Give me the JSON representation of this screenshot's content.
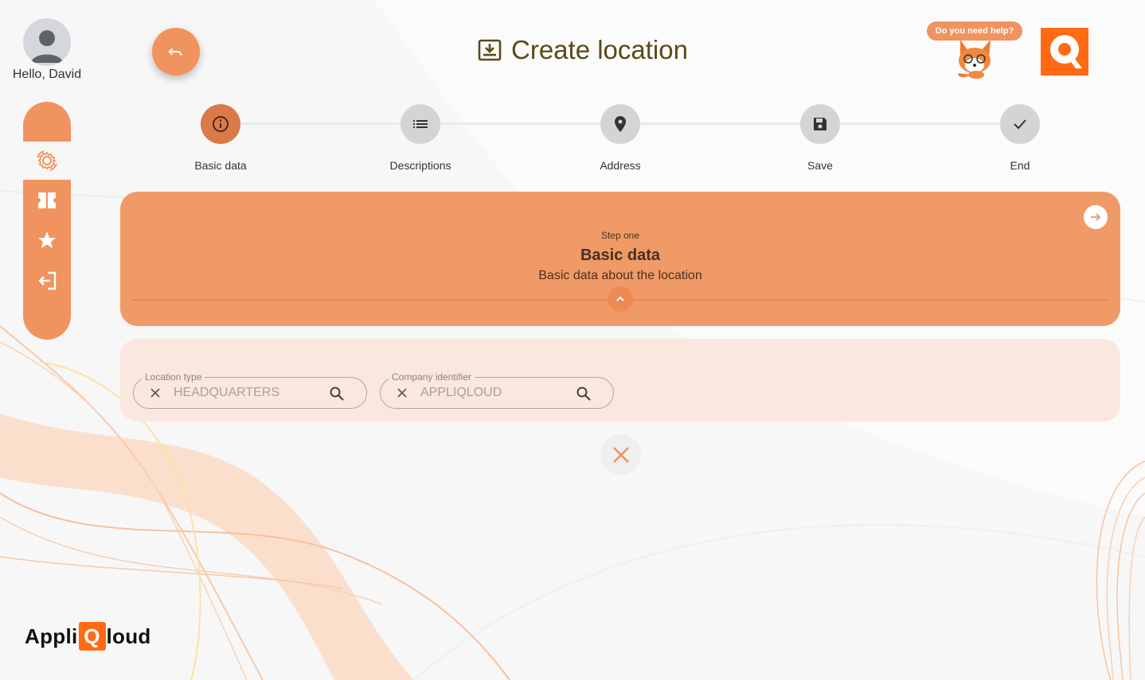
{
  "user": {
    "greeting": "Hello, David"
  },
  "header": {
    "title": "Create location"
  },
  "help": {
    "label": "Do you need help?"
  },
  "logo": {
    "letter": "Q"
  },
  "sidebar": {
    "items": [
      {
        "name": "settings",
        "active": true
      },
      {
        "name": "tickets",
        "active": false
      },
      {
        "name": "favorites",
        "active": false
      },
      {
        "name": "logout",
        "active": false
      }
    ]
  },
  "stepper": {
    "steps": [
      {
        "label": "Basic data",
        "icon": "info-icon",
        "active": true
      },
      {
        "label": "Descriptions",
        "icon": "list-icon",
        "active": false
      },
      {
        "label": "Address",
        "icon": "location-pin-icon",
        "active": false
      },
      {
        "label": "Save",
        "icon": "save-icon",
        "active": false
      },
      {
        "label": "End",
        "icon": "check-icon",
        "active": false
      }
    ]
  },
  "step_card": {
    "step_number": "Step one",
    "title": "Basic data",
    "subtitle": "Basic data about the location"
  },
  "form": {
    "location_type": {
      "label": "Location type",
      "value": "HEADQUARTERS"
    },
    "company_identifier": {
      "label": "Company identifier",
      "value": "APPLIQLOUD"
    }
  },
  "brand": {
    "prefix": "Appli",
    "q": "Q",
    "suffix": "loud"
  },
  "colors": {
    "accent": "#f0935e",
    "active_step": "#d97a48",
    "title": "#5b4a17",
    "logo": "#ff6a13"
  }
}
